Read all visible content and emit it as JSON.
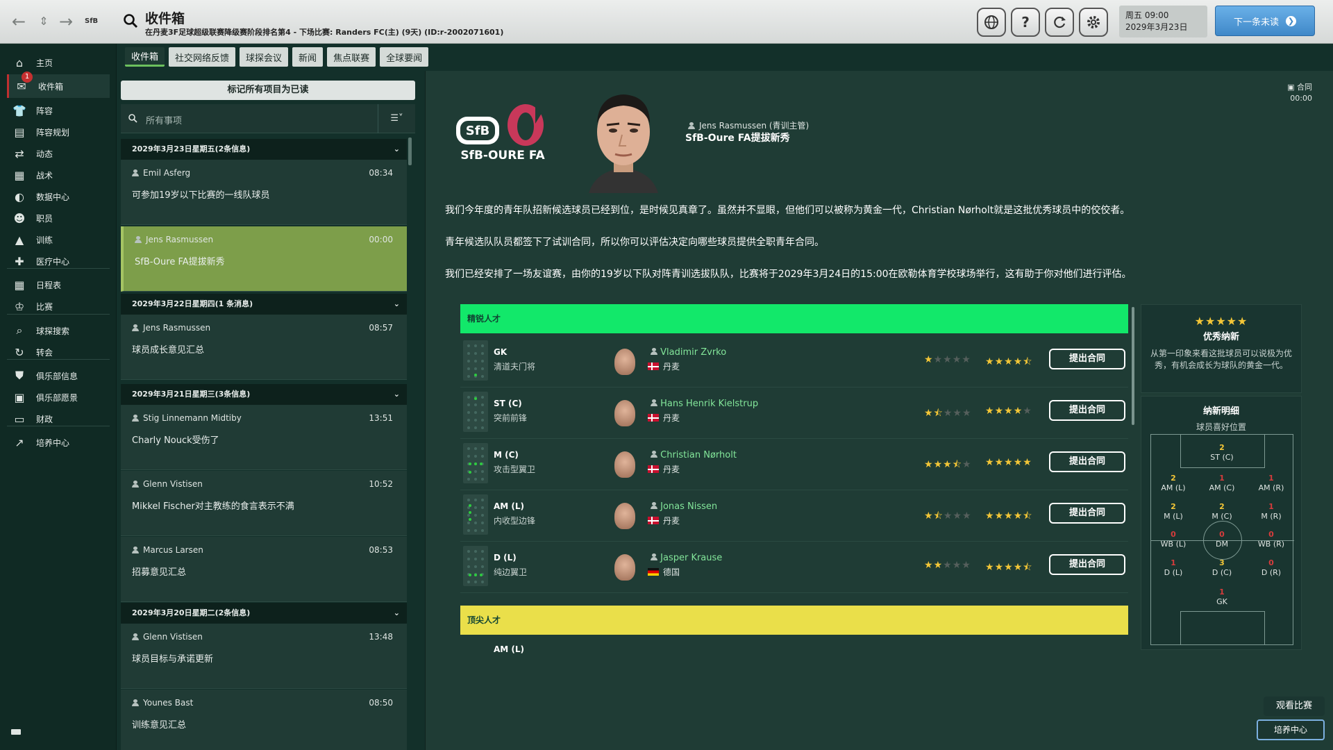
{
  "topbar": {
    "title": "收件箱",
    "subtitle": "在丹麦3F足球超级联赛降级赛阶段排名第4 - 下场比赛: Randers FC(主) (9天) (ID:r-2002071601)",
    "logo_text": "SfB",
    "date_line1": "周五 09:00",
    "date_line2": "2029年3月23日",
    "continue_label": "下一条未读",
    "help_icon": "?"
  },
  "sidebar": {
    "badge": "1",
    "items": [
      {
        "label": "主页",
        "icon": "home-icon"
      },
      {
        "label": "收件箱",
        "icon": "inbox-icon"
      },
      {
        "label": "阵容",
        "icon": "squad-icon"
      },
      {
        "label": "阵容规划",
        "icon": "squad-planner-icon"
      },
      {
        "label": "动态",
        "icon": "dynamics-icon"
      },
      {
        "label": "战术",
        "icon": "tactics-icon"
      },
      {
        "label": "数据中心",
        "icon": "data-hub-icon"
      },
      {
        "label": "职员",
        "icon": "staff-icon"
      },
      {
        "label": "训练",
        "icon": "training-icon"
      },
      {
        "label": "医疗中心",
        "icon": "medical-icon"
      },
      {
        "label": "日程表",
        "icon": "schedule-icon"
      },
      {
        "label": "比赛",
        "icon": "trophy-icon"
      },
      {
        "label": "球探搜索",
        "icon": "scouting-icon"
      },
      {
        "label": "转会",
        "icon": "transfers-icon"
      },
      {
        "label": "俱乐部信息",
        "icon": "club-info-icon"
      },
      {
        "label": "俱乐部愿景",
        "icon": "club-vision-icon"
      },
      {
        "label": "财政",
        "icon": "finances-icon"
      },
      {
        "label": "培养中心",
        "icon": "development-icon"
      }
    ]
  },
  "tabs": [
    "收件箱",
    "社交网络反馈",
    "球探会议",
    "新闻",
    "焦点联赛",
    "全球要闻"
  ],
  "inbox": {
    "mark_all_read": "标记所有项目为已读",
    "filter_placeholder": "所有事项",
    "groups": [
      {
        "header": "2029年3月23日星期五(2条信息)"
      },
      {
        "header": "2029年3月22日星期四(1 条消息)"
      },
      {
        "header": "2029年3月21日星期三(3条信息)"
      },
      {
        "header": "2029年3月20日星期二(2条信息)"
      }
    ],
    "messages": [
      {
        "sender": "Emil Asferg",
        "time": "08:34",
        "subject": "可参加19岁以下比赛的一线队球员"
      },
      {
        "sender": "Jens Rasmussen",
        "time": "00:00",
        "subject": "SfB-Oure FA提拔新秀"
      },
      {
        "sender": "Jens Rasmussen",
        "time": "08:57",
        "subject": "球员成长意见汇总"
      },
      {
        "sender": "Stig Linnemann Midtiby",
        "time": "13:51",
        "subject": "Charly Nouck受伤了"
      },
      {
        "sender": "Glenn Vistisen",
        "time": "10:52",
        "subject": "Mikkel Fischer对主教练的食言表示不满"
      },
      {
        "sender": "Marcus Larsen",
        "time": "08:53",
        "subject": "招募意见汇总"
      },
      {
        "sender": "Glenn Vistisen",
        "time": "13:48",
        "subject": "球员目标与承诺更新"
      },
      {
        "sender": "Younes Bast",
        "time": "08:50",
        "subject": "训练意见汇总"
      }
    ]
  },
  "message": {
    "club_logo_text": "SfB-OURE FA",
    "club_logo_short": "SfB",
    "from": "Jens Rasmussen (青训主管)",
    "title": "SfB-Oure FA提拔新秀",
    "merge_label": "合同",
    "merge_time": "00:00",
    "paragraphs": [
      "我们今年度的青年队招新候选球员已经到位，是时候见真章了。虽然并不显眼，但他们可以被称为黄金一代，Christian Nørholt就是这批优秀球员中的佼佼者。",
      "青年候选队队员都签下了试训合同，所以你可以评估决定向哪些球员提供全职青年合同。",
      "我们已经安排了一场友谊赛，由你的19岁以下队对阵青训选拔队队，比赛将于2029年3月24日的15:00在欧勒体育学校球场举行，这有助于你对他们进行评估。"
    ]
  },
  "intake": {
    "category1": "精锐人才",
    "category2": "顶尖人才",
    "category1_color": "#12e86a",
    "category2_color": "#eadf4a",
    "offer_label": "提出合同",
    "players": [
      {
        "pos": "GK",
        "role": "清道夫门将",
        "name": "Vladimir Zvrko",
        "nation": "丹麦",
        "flag": "dk",
        "ca": 1,
        "pa": 4.5
      },
      {
        "pos": "ST (C)",
        "role": "突前前锋",
        "name": "Hans Henrik Kielstrup",
        "nation": "丹麦",
        "flag": "dk",
        "ca": 1.5,
        "pa": 4
      },
      {
        "pos": "M (C)",
        "role": "攻击型翼卫",
        "name": "Christian Nørholt",
        "nation": "丹麦",
        "flag": "dk",
        "ca": 3.5,
        "pa": 5
      },
      {
        "pos": "AM (L)",
        "role": "内收型边锋",
        "name": "Jonas Nissen",
        "nation": "丹麦",
        "flag": "dk",
        "ca": 1.5,
        "pa": 4.5
      },
      {
        "pos": "D (L)",
        "role": "纯边翼卫",
        "name": "Jasper Krause",
        "nation": "德国",
        "flag": "de",
        "ca": 2,
        "pa": 4.5
      }
    ],
    "partial_pos": "AM (L)"
  },
  "rating": {
    "stars": "★★★★★",
    "title": "优秀纳新",
    "desc": "从第一印象来看这批球员可以说极为优秀，有机会成长为球队的黄金一代。"
  },
  "detail": {
    "title": "纳新明细",
    "subtitle": "球员喜好位置",
    "positions": [
      {
        "label": "ST (C)",
        "count": "2",
        "color": "y"
      },
      {
        "label": "AM (L)",
        "count": "2",
        "color": "y"
      },
      {
        "label": "AM (C)",
        "count": "1",
        "color": "r"
      },
      {
        "label": "AM (R)",
        "count": "1",
        "color": "r"
      },
      {
        "label": "M (L)",
        "count": "2",
        "color": "y"
      },
      {
        "label": "M (C)",
        "count": "2",
        "color": "y"
      },
      {
        "label": "M (R)",
        "count": "1",
        "color": "r"
      },
      {
        "label": "WB (L)",
        "count": "0",
        "color": "r"
      },
      {
        "label": "DM",
        "count": "0",
        "color": "r"
      },
      {
        "label": "WB (R)",
        "count": "0",
        "color": "r"
      },
      {
        "label": "D (L)",
        "count": "1",
        "color": "r"
      },
      {
        "label": "D (C)",
        "count": "3",
        "color": "y"
      },
      {
        "label": "D (R)",
        "count": "0",
        "color": "r"
      },
      {
        "label": "GK",
        "count": "1",
        "color": "r"
      }
    ]
  },
  "footer": {
    "watch_match": "观看比赛",
    "dev_center": "培养中心"
  }
}
